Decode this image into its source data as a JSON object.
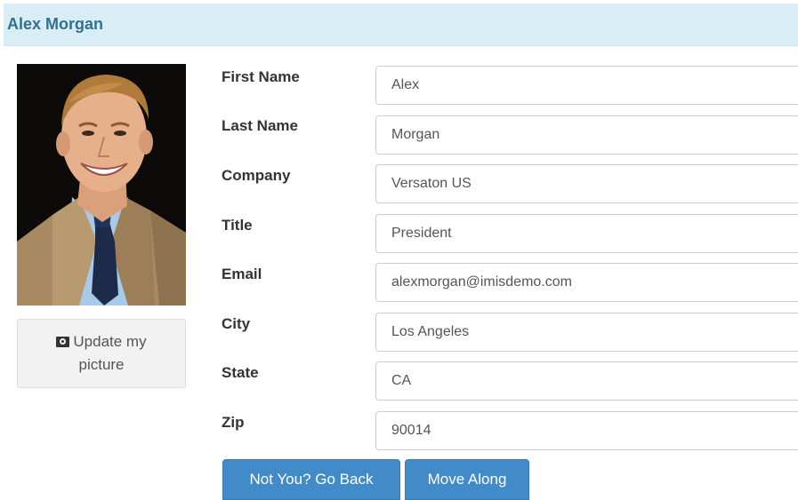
{
  "header": {
    "title": "Alex Morgan"
  },
  "profile": {
    "update_picture": {
      "icon": "camera-icon",
      "line1": "Update my",
      "line2": "picture"
    }
  },
  "form": {
    "fields": [
      {
        "label": "First Name",
        "value": "Alex"
      },
      {
        "label": "Last Name",
        "value": "Morgan"
      },
      {
        "label": "Company",
        "value": "Versaton US"
      },
      {
        "label": "Title",
        "value": "President"
      },
      {
        "label": "Email",
        "value": "alexmorgan@imisdemo.com"
      },
      {
        "label": "City",
        "value": "Los Angeles"
      },
      {
        "label": "State",
        "value": "CA"
      },
      {
        "label": "Zip",
        "value": "90014"
      }
    ]
  },
  "actions": {
    "go_back_label": "Not You? Go Back",
    "move_along_label": "Move Along"
  },
  "colors": {
    "header_bg": "#d9edf7",
    "header_text": "#31708f",
    "primary_button": "#428bca"
  }
}
